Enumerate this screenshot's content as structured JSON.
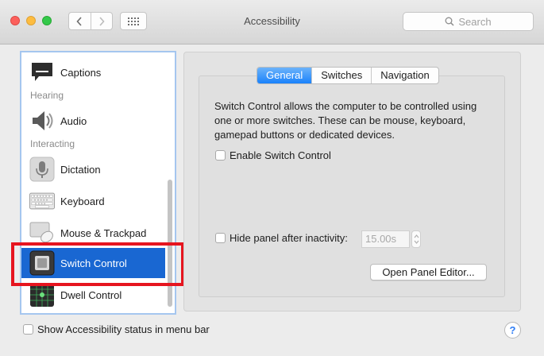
{
  "window": {
    "title": "Accessibility",
    "traffic_lights": {
      "close": "#fc605c",
      "minimize": "#fdbc40",
      "maximize": "#34c84a"
    }
  },
  "toolbar": {
    "back_icon": "chevron-left-icon",
    "forward_icon": "chevron-right-icon",
    "grid_icon": "show-all-grid-icon",
    "search": {
      "placeholder": "Search",
      "icon": "magnifier-icon"
    }
  },
  "sidebar": {
    "items": [
      {
        "label": "Captions",
        "icon": "captions-icon"
      },
      {
        "label": "Audio",
        "icon": "speaker-icon"
      },
      {
        "label": "Dictation",
        "icon": "microphone-icon"
      },
      {
        "label": "Keyboard",
        "icon": "keyboard-icon"
      },
      {
        "label": "Mouse & Trackpad",
        "icon": "mouse-icon"
      },
      {
        "label": "Switch Control",
        "icon": "switch-control-icon",
        "selected": true
      },
      {
        "label": "Dwell Control",
        "icon": "dwell-control-icon"
      }
    ],
    "sections": {
      "hearing": "Hearing",
      "interacting": "Interacting"
    },
    "selection_color": "#1967d2",
    "highlight_color": "#e6151f"
  },
  "tabs": [
    {
      "label": "General",
      "active": true
    },
    {
      "label": "Switches",
      "active": false
    },
    {
      "label": "Navigation",
      "active": false
    }
  ],
  "general": {
    "description": "Switch Control allows the computer to be controlled using one or more switches. These can be mouse, keyboard, gamepad buttons or dedicated devices.",
    "enable_label": "Enable Switch Control",
    "enable_checked": false,
    "hide_panel_label": "Hide panel after inactivity:",
    "hide_panel_checked": false,
    "hide_panel_value": "15.00s",
    "open_editor_label": "Open Panel Editor..."
  },
  "footer": {
    "status_label": "Show Accessibility status in menu bar",
    "status_checked": false,
    "help_label": "?"
  }
}
